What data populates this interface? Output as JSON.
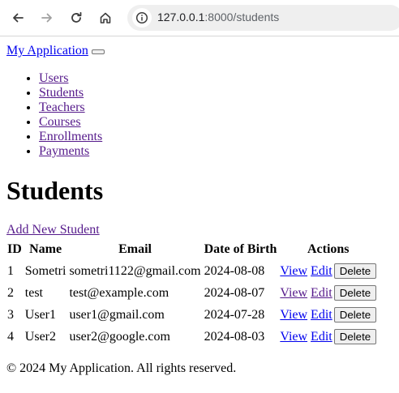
{
  "browser": {
    "url_host": "127.0.0.1",
    "url_rest": ":8000/students",
    "back_icon": "arrow-left-icon",
    "forward_icon": "arrow-right-icon",
    "reload_icon": "reload-icon",
    "home_icon": "home-icon",
    "info_icon": "info-icon"
  },
  "navbar": {
    "brand": "My Application",
    "items": [
      {
        "label": "Users"
      },
      {
        "label": "Students"
      },
      {
        "label": "Teachers"
      },
      {
        "label": "Courses"
      },
      {
        "label": "Enrollments"
      },
      {
        "label": "Payments"
      }
    ]
  },
  "main": {
    "title": "Students",
    "add_link": "Add New Student",
    "table": {
      "headers": [
        "ID",
        "Name",
        "Email",
        "Date of Birth",
        "Actions"
      ],
      "rows": [
        {
          "id": "1",
          "name": "Sometri",
          "email": "sometri1122@gmail.com",
          "dob": "2024-08-08"
        },
        {
          "id": "2",
          "name": "test",
          "email": "test@example.com",
          "dob": "2024-08-07"
        },
        {
          "id": "3",
          "name": "User1",
          "email": "user1@gmail.com",
          "dob": "2024-07-28"
        },
        {
          "id": "4",
          "name": "User2",
          "email": "user2@google.com",
          "dob": "2024-08-03"
        }
      ],
      "actions": {
        "view": "View",
        "edit": "Edit",
        "delete": "Delete"
      }
    }
  },
  "footer": {
    "text": "© 2024 My Application. All rights reserved."
  }
}
